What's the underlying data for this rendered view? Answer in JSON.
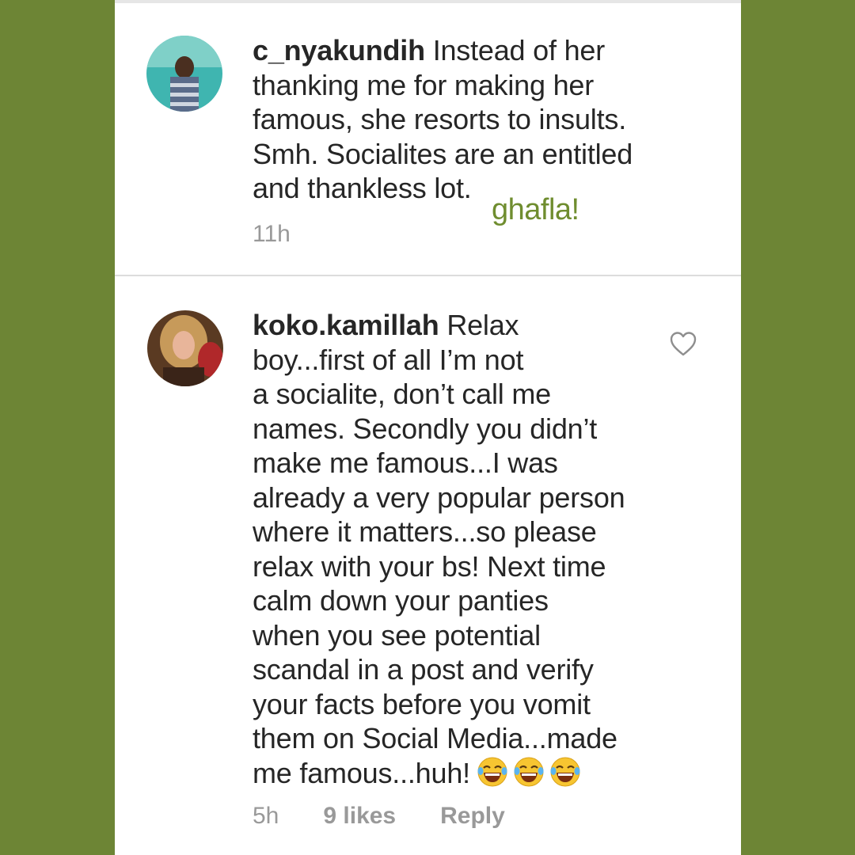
{
  "comments": [
    {
      "username": "c_nyakundih",
      "lines": [
        "Instead of her",
        "thanking me for making her",
        "famous, she resorts to insults.",
        "Smh. Socialites are an entitled",
        "and thankless lot."
      ],
      "time": "11h"
    },
    {
      "username": "koko.kamillah",
      "lines": [
        "Relax",
        "boy...first of all I’m not",
        "a socialite, don’t call me",
        "names. Secondly you didn’t",
        "make me famous...I was",
        "already a very popular person",
        "where it matters...so please",
        "relax with your bs! Next time",
        "calm down your panties",
        "when you see potential",
        "scandal in a post and verify",
        "your facts before you vomit",
        "them on Social Media...made",
        "me famous...huh!"
      ],
      "emoji": "😂😂😂",
      "time": "5h",
      "likes": "9 likes",
      "reply_label": "Reply"
    }
  ],
  "watermark": "ghafla!",
  "colors": {
    "background": "#6d8535",
    "watermark": "#6f8d2f",
    "text": "#262626",
    "meta": "#999999"
  },
  "icons": [
    "heart-icon",
    "laugh-emoji"
  ]
}
